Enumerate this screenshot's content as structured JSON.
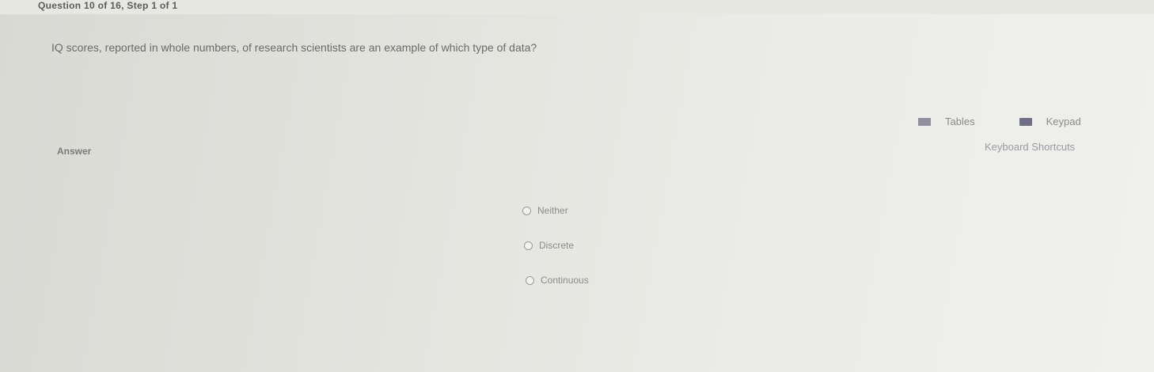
{
  "header": {
    "question_counter": "Question 10 of 16, Step 1 of 1"
  },
  "question": {
    "text": "IQ scores, reported in whole numbers, of research scientists are an example of which type of data?"
  },
  "tools": {
    "tables_label": "Tables",
    "keypad_label": "Keypad",
    "shortcuts_label": "Keyboard Shortcuts"
  },
  "answer": {
    "label": "Answer",
    "options": [
      {
        "label": "Neither"
      },
      {
        "label": "Discrete"
      },
      {
        "label": "Continuous"
      }
    ]
  }
}
